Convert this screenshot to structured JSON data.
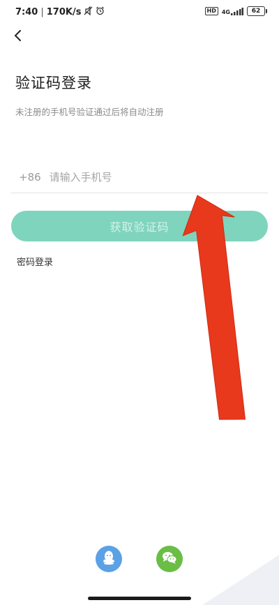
{
  "status_bar": {
    "time": "7:40",
    "speed": "170K/s",
    "hd": "HD",
    "network": "4G",
    "battery": "62"
  },
  "header": {
    "title": "验证码登录",
    "subtitle": "未注册的手机号验证通过后将自动注册"
  },
  "form": {
    "country_code": "+86",
    "phone_placeholder": "请输入手机号",
    "phone_value": "",
    "get_code_label": "获取验证码",
    "password_login_label": "密码登录"
  },
  "social": {
    "icons": [
      "qq-icon",
      "wechat-icon"
    ]
  },
  "colors": {
    "accent": "#7fd4bd",
    "button_text": "#d6f1ea",
    "qq": "#5aa1e5",
    "wechat": "#6abd45",
    "annotation_arrow": "#e8391d"
  }
}
